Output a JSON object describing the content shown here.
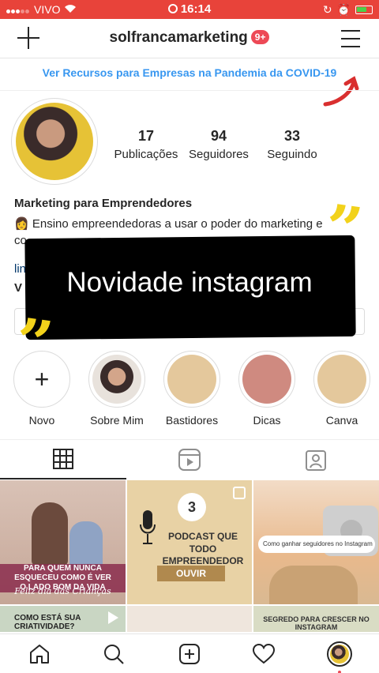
{
  "status_bar": {
    "carrier": "VIVO",
    "time": "16:14",
    "bg_color": "#e8433a"
  },
  "header": {
    "username": "solfrancamarketing",
    "notification_badge": "9+",
    "new_post_icon": "plus-icon",
    "menu_icon": "hamburger-menu-icon"
  },
  "covid_banner": {
    "text": "Ver Recursos para Empresas na Pandemia da COVID-19",
    "color": "#3897f0"
  },
  "profile": {
    "stats": [
      {
        "value": "17",
        "label": "Publicações"
      },
      {
        "value": "94",
        "label": "Seguidores"
      },
      {
        "value": "33",
        "label": "Seguindo"
      }
    ],
    "bio_name": "Marketing para Emprendedores",
    "bio_line": "Ensino empreendedoras a usar o poder do marketing e",
    "bio_fragments": [
      "co",
      "lin",
      "V"
    ]
  },
  "overlay": {
    "text": "Novidade instagram",
    "quote_mark": "”",
    "accent": "#f2d21b"
  },
  "stories": [
    {
      "label": "Novo",
      "icon": "plus-icon"
    },
    {
      "label": "Sobre Mim"
    },
    {
      "label": "Bastidores"
    },
    {
      "label": "Dicas"
    },
    {
      "label": "Canva"
    }
  ],
  "profile_tabs": [
    "grid-icon",
    "reels-icon",
    "tagged-icon"
  ],
  "posts": [
    {
      "caption": "PARA QUEM NUNCA ESQUECEU COMO É VER O LADO BOM DA VIDA",
      "script": "Feliz dia das Crianças"
    },
    {
      "badge": "3",
      "title": "PODCAST QUE TODO EMPREENDEDOR DEVERIA",
      "button": "OUVIR"
    },
    {
      "search_text": "Como ganhar seguidores no Instagram"
    },
    {
      "caption": "COMO ESTÁ SUA CRIATIVIDADE?"
    },
    {},
    {
      "caption": "SEGREDO PARA CRESCER NO INSTAGRAM"
    }
  ],
  "bottom_nav": [
    "home-icon",
    "search-icon",
    "new-post-icon",
    "activity-heart-icon",
    "profile-avatar-icon"
  ]
}
